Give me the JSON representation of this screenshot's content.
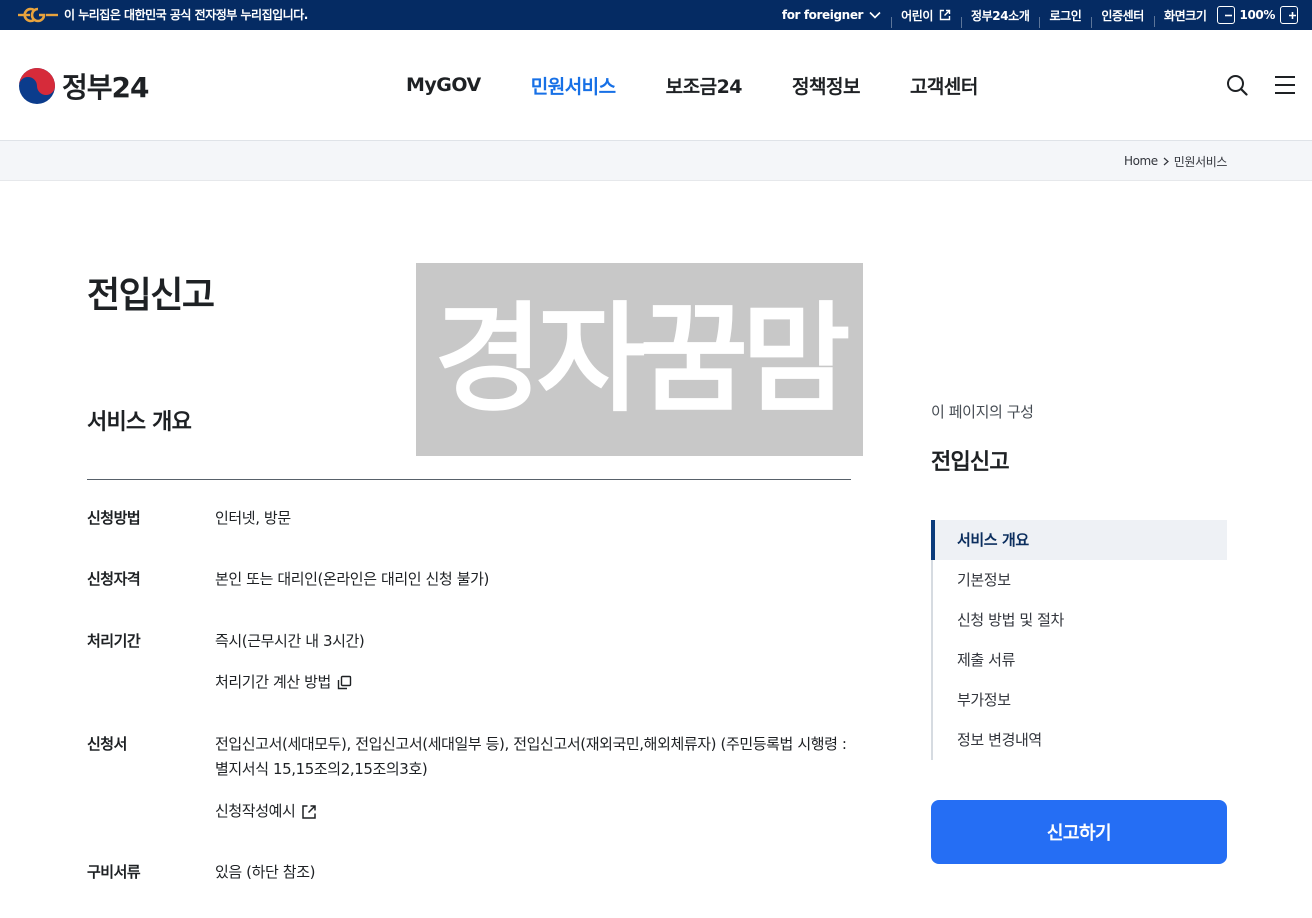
{
  "banner": {
    "notice": "이 누리집은 대한민국 공식 전자정부 누리집입니다.",
    "links": {
      "foreigner": "for foreigner",
      "kids": "어린이",
      "about": "정부24소개",
      "login": "로그인",
      "cert": "인증센터",
      "zoom_label": "화면크기",
      "zoom_value": "100%"
    }
  },
  "header": {
    "brand": "정부24",
    "nav": [
      "MyGOV",
      "민원서비스",
      "보조금24",
      "정책정보",
      "고객센터"
    ],
    "active_nav": "민원서비스"
  },
  "breadcrumb": [
    "Home",
    "민원서비스"
  ],
  "page": {
    "title": "전입신고",
    "watermark": "경자꿈맘",
    "section_title": "서비스 개요",
    "rows": [
      {
        "label": "신청방법",
        "value": "인터넷, 방문"
      },
      {
        "label": "신청자격",
        "value": "본인 또는 대리인(온라인은 대리인 신청 불가)"
      },
      {
        "label": "처리기간",
        "value": "즉시(근무시간 내 3시간)",
        "link": "처리기간 계산 방법"
      },
      {
        "label": "신청서",
        "value": "전입신고서(세대모두), 전입신고서(세대일부 등), 전입신고서(재외국민,해외체류자) (주민등록법 시행령 : 별지서식 15,15조의2,15조의3호)",
        "link": "신청작성예시"
      },
      {
        "label": "구비서류",
        "value": "있음 (하단 참조)"
      }
    ]
  },
  "toc": {
    "caption": "이 페이지의 구성",
    "title": "전입신고",
    "items": [
      "서비스 개요",
      "기본정보",
      "신청 방법 및 절차",
      "제출 서류",
      "부가정보",
      "정보 변경내역"
    ],
    "active": "서비스 개요",
    "button": "신고하기"
  },
  "colors": {
    "banner_bg": "#052b63",
    "accent": "#1770e6",
    "button_bg": "#256ef4"
  }
}
